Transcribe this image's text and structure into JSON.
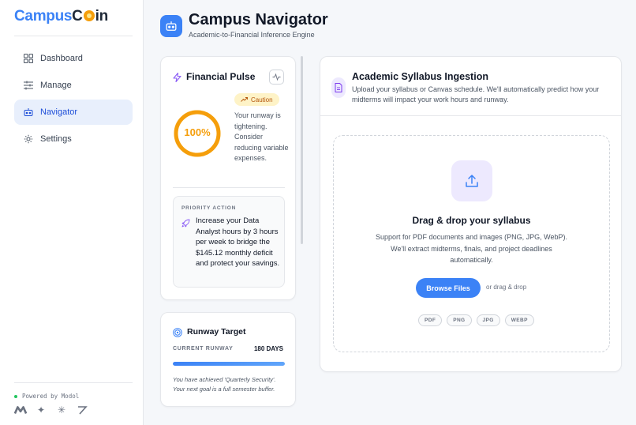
{
  "brand": {
    "part1": "Campus",
    "part2": "C",
    "part3": "in"
  },
  "sidebar": {
    "items": [
      {
        "label": "Dashboard",
        "icon": "grid-icon"
      },
      {
        "label": "Manage",
        "icon": "sliders-icon"
      },
      {
        "label": "Navigator",
        "icon": "robot-icon",
        "active": true
      },
      {
        "label": "Settings",
        "icon": "gear-icon"
      }
    ],
    "powered_by": "Powered by Modol"
  },
  "header": {
    "title": "Campus Navigator",
    "subtitle": "Academic-to-Financial Inference Engine"
  },
  "pulse": {
    "title": "Financial Pulse",
    "score_label": "100%",
    "score_fraction": 1.0,
    "status_badge": "Caution",
    "status_text": "Your runway is tightening. Consider reducing variable expenses.",
    "priority_label": "PRIORITY ACTION",
    "priority_text": "Increase your Data Analyst hours by 3 hours per week to bridge the $145.12 monthly deficit and protect your savings."
  },
  "runway": {
    "title": "Runway Target",
    "label": "CURRENT RUNWAY",
    "value": "180 DAYS",
    "progress": 1.0,
    "note": "You have achieved 'Quarterly Security'. Your next goal is a full semester buffer."
  },
  "ingest": {
    "title": "Academic Syllabus Ingestion",
    "subtitle": "Upload your syllabus or Canvas schedule. We'll automatically predict how your midterms will impact your work hours and runway.",
    "drop_title": "Drag & drop your syllabus",
    "drop_text": "Support for PDF documents and images (PNG, JPG, WebP). We'll extract midterms, finals, and project deadlines automatically.",
    "browse_label": "Browse Files",
    "or_label": "or drag & drop",
    "formats": [
      "PDF",
      "PNG",
      "JPG",
      "WEBP"
    ]
  },
  "colors": {
    "accent": "#3b82f6",
    "warning": "#f59e0b",
    "purple": "#8b5cf6"
  }
}
